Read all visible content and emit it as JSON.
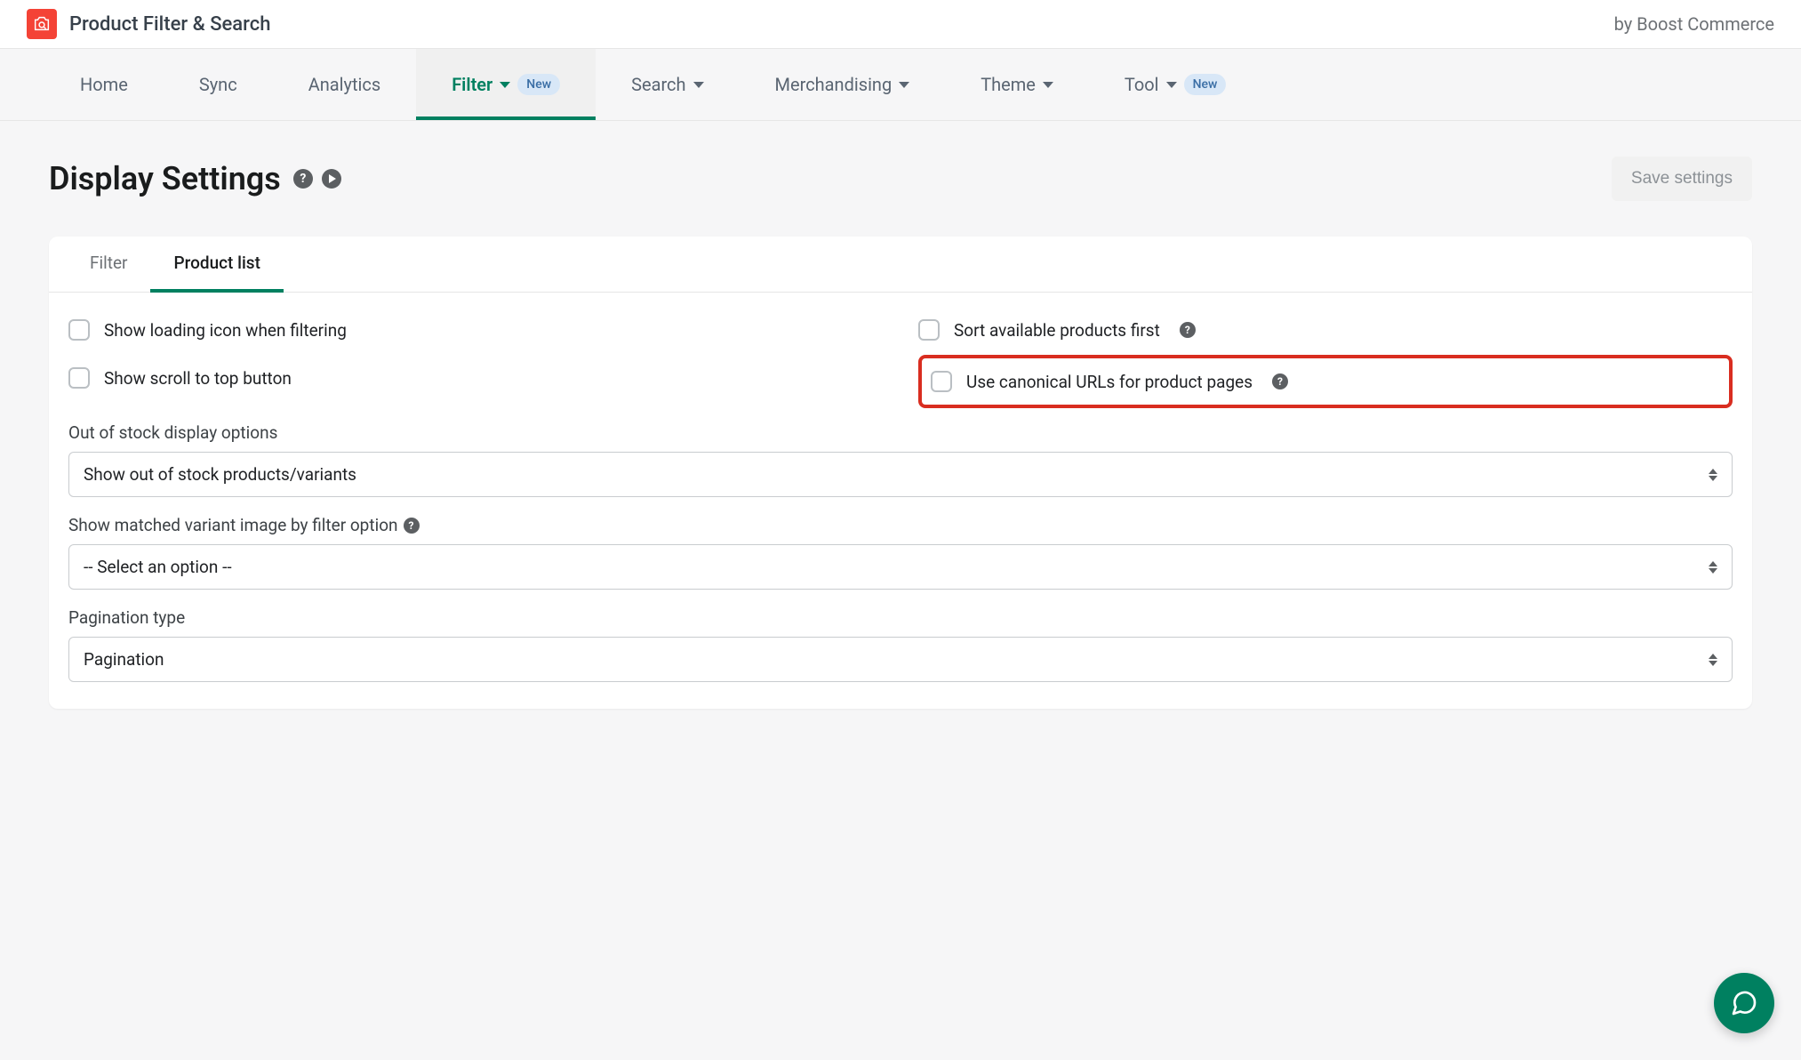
{
  "header": {
    "app_title": "Product Filter & Search",
    "by_text": "by Boost Commerce"
  },
  "nav": {
    "home": "Home",
    "sync": "Sync",
    "analytics": "Analytics",
    "filter": "Filter",
    "search": "Search",
    "merchandising": "Merchandising",
    "theme": "Theme",
    "tool": "Tool",
    "badge_new": "New"
  },
  "page": {
    "title": "Display Settings",
    "save_label": "Save settings"
  },
  "tabs": {
    "filter": "Filter",
    "product_list": "Product list"
  },
  "checkboxes": {
    "show_loading": "Show loading icon when filtering",
    "show_scroll_top": "Show scroll to top button",
    "sort_available": "Sort available products first",
    "canonical": "Use canonical URLs for product pages"
  },
  "form": {
    "oos_label": "Out of stock display options",
    "oos_value": "Show out of stock products/variants",
    "variant_label": "Show matched variant image by filter option",
    "variant_value": "-- Select an option --",
    "pagination_label": "Pagination type",
    "pagination_value": "Pagination"
  }
}
